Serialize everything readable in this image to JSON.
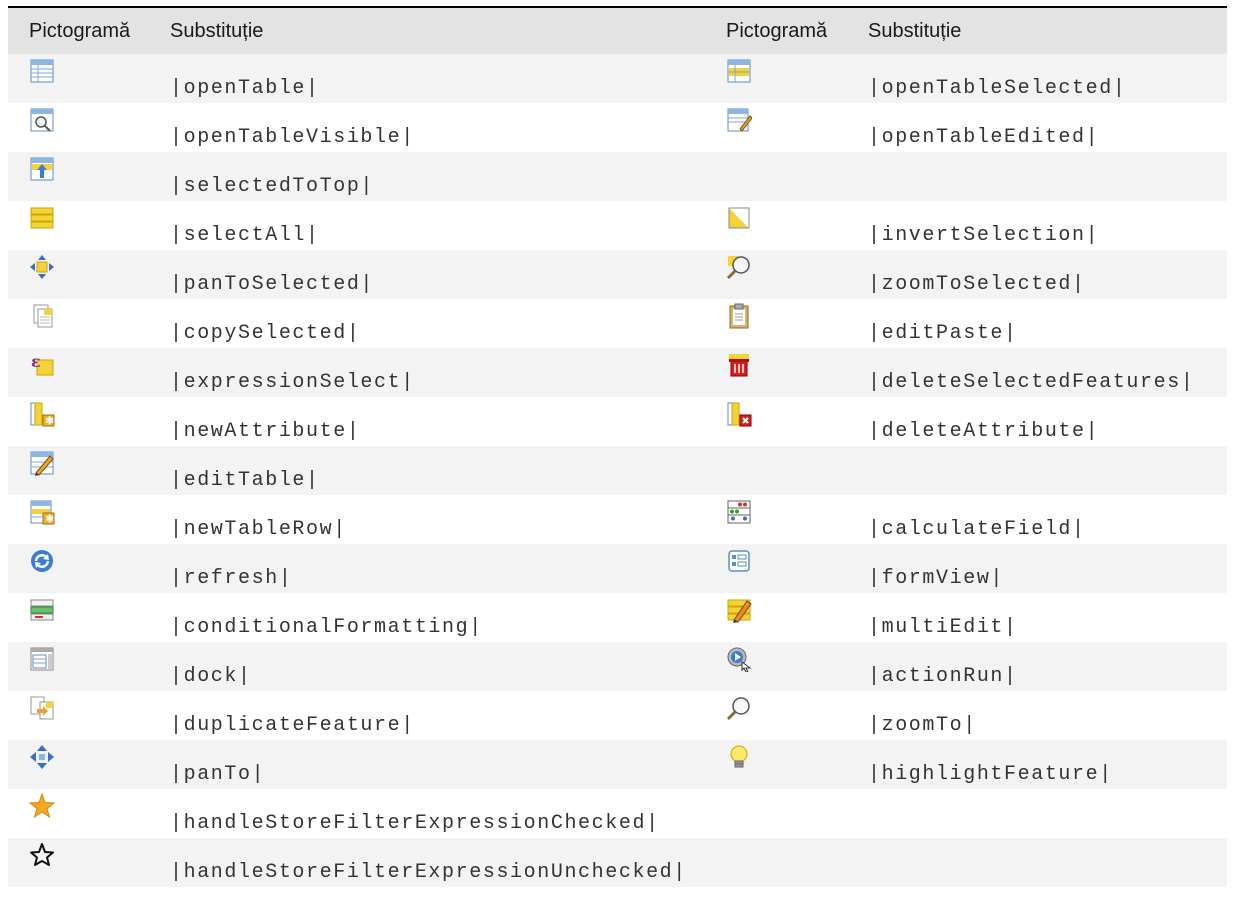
{
  "table": {
    "headers": [
      "Pictogramă",
      "Substituție",
      "Pictogramă",
      "Substituție"
    ],
    "rows": [
      {
        "left": {
          "icon": "open-table-icon",
          "code": "|openTable|"
        },
        "right": {
          "icon": "open-table-selected-icon",
          "code": "|openTableSelected|"
        }
      },
      {
        "left": {
          "icon": "open-table-visible-icon",
          "code": "|openTableVisible|"
        },
        "right": {
          "icon": "open-table-edited-icon",
          "code": "|openTableEdited|"
        }
      },
      {
        "left": {
          "icon": "selected-to-top-icon",
          "code": "|selectedToTop|"
        },
        "right": null
      },
      {
        "left": {
          "icon": "select-all-icon",
          "code": "|selectAll|"
        },
        "right": {
          "icon": "invert-selection-icon",
          "code": "|invertSelection|"
        }
      },
      {
        "left": {
          "icon": "pan-to-selected-icon",
          "code": "|panToSelected|"
        },
        "right": {
          "icon": "zoom-to-selected-icon",
          "code": "|zoomToSelected|"
        }
      },
      {
        "left": {
          "icon": "copy-selected-icon",
          "code": "|copySelected|"
        },
        "right": {
          "icon": "edit-paste-icon",
          "code": "|editPaste|"
        }
      },
      {
        "left": {
          "icon": "expression-select-icon",
          "code": "|expressionSelect|"
        },
        "right": {
          "icon": "delete-selected-features-icon",
          "code": "|deleteSelectedFeatures|"
        }
      },
      {
        "left": {
          "icon": "new-attribute-icon",
          "code": "|newAttribute|"
        },
        "right": {
          "icon": "delete-attribute-icon",
          "code": "|deleteAttribute|"
        }
      },
      {
        "left": {
          "icon": "edit-table-icon",
          "code": "|editTable|"
        },
        "right": null
      },
      {
        "left": {
          "icon": "new-table-row-icon",
          "code": "|newTableRow|"
        },
        "right": {
          "icon": "calculate-field-icon",
          "code": "|calculateField|"
        }
      },
      {
        "left": {
          "icon": "refresh-icon",
          "code": "|refresh|"
        },
        "right": {
          "icon": "form-view-icon",
          "code": "|formView|"
        }
      },
      {
        "left": {
          "icon": "conditional-formatting-icon",
          "code": "|conditionalFormatting|"
        },
        "right": {
          "icon": "multi-edit-icon",
          "code": "|multiEdit|"
        }
      },
      {
        "left": {
          "icon": "dock-icon",
          "code": "|dock|"
        },
        "right": {
          "icon": "action-run-icon",
          "code": "|actionRun|"
        }
      },
      {
        "left": {
          "icon": "duplicate-feature-icon",
          "code": "|duplicateFeature|"
        },
        "right": {
          "icon": "zoom-to-icon",
          "code": "|zoomTo|"
        }
      },
      {
        "left": {
          "icon": "pan-to-icon",
          "code": "|panTo|"
        },
        "right": {
          "icon": "highlight-feature-icon",
          "code": "|highlightFeature|"
        }
      },
      {
        "left": {
          "icon": "star-filled-icon",
          "code": "|handleStoreFilterExpressionChecked|"
        },
        "right": null
      },
      {
        "left": {
          "icon": "star-outline-icon",
          "code": "|handleStoreFilterExpressionUnchecked|"
        },
        "right": null
      }
    ]
  }
}
